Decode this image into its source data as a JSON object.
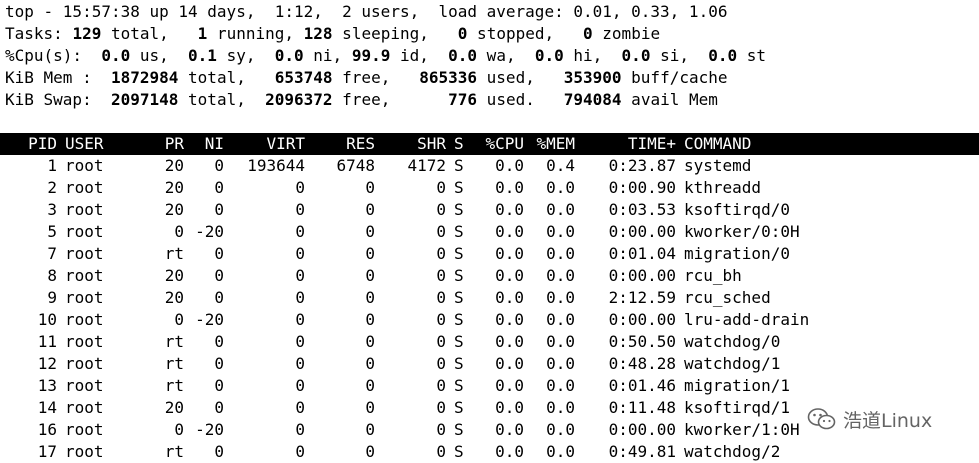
{
  "summary": {
    "line1": "top - 15:57:38 up 14 days,  1:12,  2 users,  load average: 0.01, 0.33, 1.06",
    "tasks": {
      "label": "Tasks: ",
      "total": "129",
      "t_total": " total,   ",
      "running": "1",
      "t_running": " running, ",
      "sleeping": "128",
      "t_sleeping": " sleeping,   ",
      "stopped": "0",
      "t_stopped": " stopped,   ",
      "zombie": "0",
      "t_zombie": " zombie"
    },
    "cpu": {
      "label": "%Cpu(s):  ",
      "us": "0.0",
      "t_us": " us,  ",
      "sy": "0.1",
      "t_sy": " sy,  ",
      "ni": "0.0",
      "t_ni": " ni, ",
      "id": "99.9",
      "t_id": " id,  ",
      "wa": "0.0",
      "t_wa": " wa,  ",
      "hi": "0.0",
      "t_hi": " hi,  ",
      "si": "0.0",
      "t_si": " si,  ",
      "st": "0.0",
      "t_st": " st"
    },
    "mem": {
      "label": "KiB Mem :  ",
      "total": "1872984",
      "t_total": " total,   ",
      "free": "653748",
      "t_free": " free,   ",
      "used": "865336",
      "t_used": " used,   ",
      "buff": "353900",
      "t_buff": " buff/cache"
    },
    "swap": {
      "label": "KiB Swap:  ",
      "total": "2097148",
      "t_total": " total,  ",
      "free": "2096372",
      "t_free": " free,      ",
      "used": "776",
      "t_used": " used.   ",
      "avail": "794084",
      "t_avail": " avail Mem"
    }
  },
  "columns": [
    "PID",
    "USER",
    "PR",
    "NI",
    "VIRT",
    "RES",
    "SHR",
    "S",
    "%CPU",
    "%MEM",
    "TIME+",
    "COMMAND"
  ],
  "processes": [
    [
      "1",
      "root",
      "20",
      "0",
      "193644",
      "6748",
      "4172",
      "S",
      "0.0",
      "0.4",
      "0:23.87",
      "systemd"
    ],
    [
      "2",
      "root",
      "20",
      "0",
      "0",
      "0",
      "0",
      "S",
      "0.0",
      "0.0",
      "0:00.90",
      "kthreadd"
    ],
    [
      "3",
      "root",
      "20",
      "0",
      "0",
      "0",
      "0",
      "S",
      "0.0",
      "0.0",
      "0:03.53",
      "ksoftirqd/0"
    ],
    [
      "5",
      "root",
      "0",
      "-20",
      "0",
      "0",
      "0",
      "S",
      "0.0",
      "0.0",
      "0:00.00",
      "kworker/0:0H"
    ],
    [
      "7",
      "root",
      "rt",
      "0",
      "0",
      "0",
      "0",
      "S",
      "0.0",
      "0.0",
      "0:01.04",
      "migration/0"
    ],
    [
      "8",
      "root",
      "20",
      "0",
      "0",
      "0",
      "0",
      "S",
      "0.0",
      "0.0",
      "0:00.00",
      "rcu_bh"
    ],
    [
      "9",
      "root",
      "20",
      "0",
      "0",
      "0",
      "0",
      "S",
      "0.0",
      "0.0",
      "2:12.59",
      "rcu_sched"
    ],
    [
      "10",
      "root",
      "0",
      "-20",
      "0",
      "0",
      "0",
      "S",
      "0.0",
      "0.0",
      "0:00.00",
      "lru-add-drain"
    ],
    [
      "11",
      "root",
      "rt",
      "0",
      "0",
      "0",
      "0",
      "S",
      "0.0",
      "0.0",
      "0:50.50",
      "watchdog/0"
    ],
    [
      "12",
      "root",
      "rt",
      "0",
      "0",
      "0",
      "0",
      "S",
      "0.0",
      "0.0",
      "0:48.28",
      "watchdog/1"
    ],
    [
      "13",
      "root",
      "rt",
      "0",
      "0",
      "0",
      "0",
      "S",
      "0.0",
      "0.0",
      "0:01.46",
      "migration/1"
    ],
    [
      "14",
      "root",
      "20",
      "0",
      "0",
      "0",
      "0",
      "S",
      "0.0",
      "0.0",
      "0:11.48",
      "ksoftirqd/1"
    ],
    [
      "16",
      "root",
      "0",
      "-20",
      "0",
      "0",
      "0",
      "S",
      "0.0",
      "0.0",
      "0:00.00",
      "kworker/1:0H"
    ],
    [
      "17",
      "root",
      "rt",
      "0",
      "0",
      "0",
      "0",
      "S",
      "0.0",
      "0.0",
      "0:49.81",
      "watchdog/2"
    ]
  ],
  "watermark": {
    "icon": "wechat-icon",
    "text": "浩道Linux"
  }
}
